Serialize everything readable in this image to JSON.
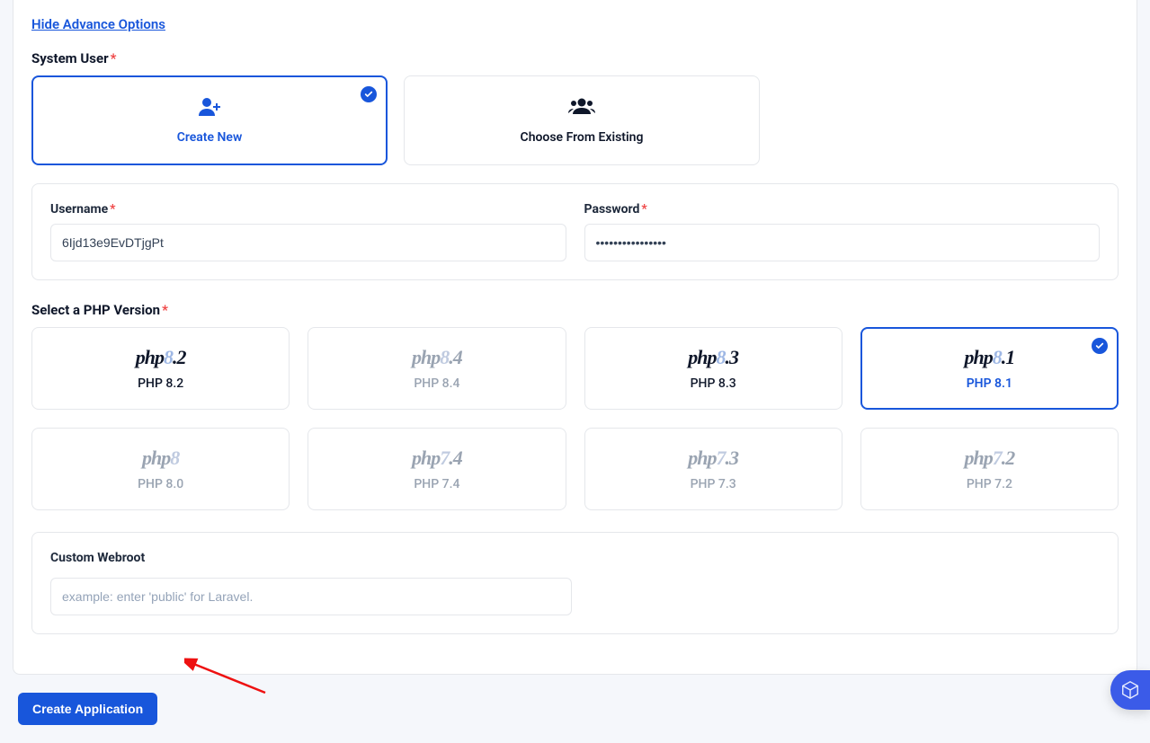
{
  "toggle_link": "Hide Advance Options",
  "system_user": {
    "label": "System User",
    "options": {
      "create_new": "Create New",
      "choose_existing": "Choose From Existing"
    },
    "selected": "create_new"
  },
  "credentials": {
    "username_label": "Username",
    "username_value": "6Ijd13e9EvDTjgPt",
    "password_label": "Password",
    "password_value": "****************"
  },
  "php_section": {
    "label": "Select a PHP Version",
    "versions": [
      {
        "logo_prefix": "php",
        "logo_accent": "8",
        "logo_suffix": ".2",
        "caption": "PHP 8.2",
        "dim": false,
        "selected": false
      },
      {
        "logo_prefix": "php",
        "logo_accent": "8",
        "logo_suffix": ".4",
        "caption": "PHP 8.4",
        "dim": true,
        "selected": false
      },
      {
        "logo_prefix": "php",
        "logo_accent": "8",
        "logo_suffix": ".3",
        "caption": "PHP 8.3",
        "dim": false,
        "selected": false
      },
      {
        "logo_prefix": "php",
        "logo_accent": "8",
        "logo_suffix": ".1",
        "caption": "PHP 8.1",
        "dim": false,
        "selected": true
      },
      {
        "logo_prefix": "php",
        "logo_accent": "8",
        "logo_suffix": "",
        "caption": "PHP 8.0",
        "dim": true,
        "selected": false
      },
      {
        "logo_prefix": "php",
        "logo_accent": "7",
        "logo_suffix": ".4",
        "caption": "PHP 7.4",
        "dim": true,
        "selected": false
      },
      {
        "logo_prefix": "php",
        "logo_accent": "7",
        "logo_suffix": ".3",
        "caption": "PHP 7.3",
        "dim": true,
        "selected": false
      },
      {
        "logo_prefix": "php",
        "logo_accent": "7",
        "logo_suffix": ".2",
        "caption": "PHP 7.2",
        "dim": true,
        "selected": false
      }
    ]
  },
  "webroot": {
    "label": "Custom Webroot",
    "placeholder": "example: enter 'public' for Laravel.",
    "value": ""
  },
  "submit_label": "Create Application"
}
